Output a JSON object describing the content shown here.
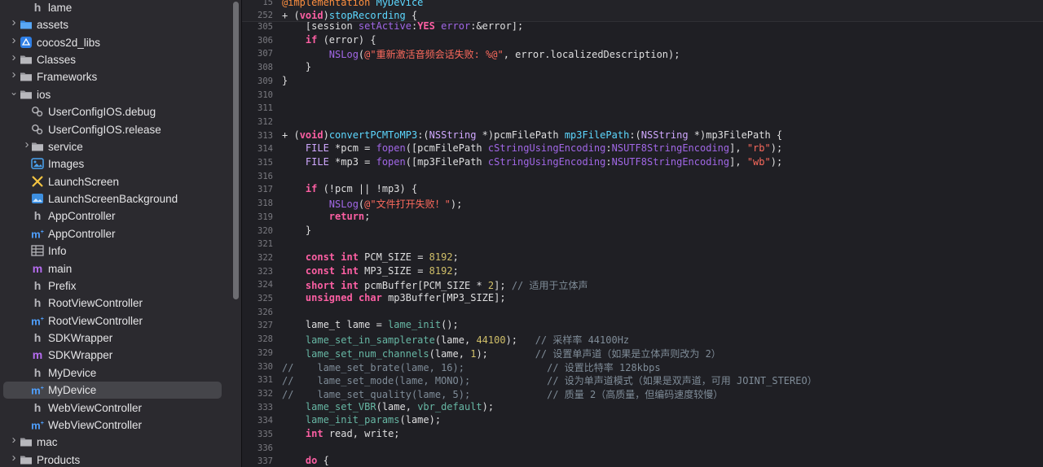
{
  "sidebar": {
    "items": [
      {
        "label": "lame",
        "icon": "header-file-icon",
        "kind": "h",
        "expandable": false,
        "indent": 1
      },
      {
        "label": "assets",
        "icon": "folder-icon-blue",
        "kind": "folder-blue",
        "expandable": true,
        "indent": 0
      },
      {
        "label": "cocos2d_libs",
        "icon": "xcode-project-icon",
        "kind": "project",
        "expandable": true,
        "indent": 0
      },
      {
        "label": "Classes",
        "icon": "folder-icon",
        "kind": "folder",
        "expandable": true,
        "indent": 0
      },
      {
        "label": "Frameworks",
        "icon": "folder-icon",
        "kind": "folder",
        "expandable": true,
        "indent": 0
      },
      {
        "label": "ios",
        "icon": "folder-icon",
        "kind": "folder",
        "expandable": true,
        "expanded": true,
        "indent": 0
      },
      {
        "label": "UserConfigIOS.debug",
        "icon": "xcconfig-icon",
        "kind": "config",
        "expandable": false,
        "indent": 1
      },
      {
        "label": "UserConfigIOS.release",
        "icon": "xcconfig-icon",
        "kind": "config",
        "expandable": false,
        "indent": 1
      },
      {
        "label": "service",
        "icon": "folder-icon",
        "kind": "folder",
        "expandable": true,
        "indent": 1
      },
      {
        "label": "Images",
        "icon": "asset-catalog-icon",
        "kind": "assets",
        "expandable": false,
        "indent": 1
      },
      {
        "label": "LaunchScreen",
        "icon": "storyboard-icon",
        "kind": "storyboard",
        "expandable": false,
        "indent": 1
      },
      {
        "label": "LaunchScreenBackground",
        "icon": "image-file-icon",
        "kind": "image",
        "expandable": false,
        "indent": 1
      },
      {
        "label": "AppController",
        "icon": "header-file-icon",
        "kind": "h",
        "expandable": false,
        "indent": 1
      },
      {
        "label": "AppController",
        "icon": "objcpp-file-icon",
        "kind": "mm",
        "expandable": false,
        "indent": 1
      },
      {
        "label": "Info",
        "icon": "plist-icon",
        "kind": "plist",
        "expandable": false,
        "indent": 1
      },
      {
        "label": "main",
        "icon": "objc-file-icon",
        "kind": "m",
        "expandable": false,
        "indent": 1
      },
      {
        "label": "Prefix",
        "icon": "header-file-icon",
        "kind": "h",
        "expandable": false,
        "indent": 1
      },
      {
        "label": "RootViewController",
        "icon": "header-file-icon",
        "kind": "h",
        "expandable": false,
        "indent": 1
      },
      {
        "label": "RootViewController",
        "icon": "objcpp-file-icon",
        "kind": "mm",
        "expandable": false,
        "indent": 1
      },
      {
        "label": "SDKWrapper",
        "icon": "header-file-icon",
        "kind": "h",
        "expandable": false,
        "indent": 1
      },
      {
        "label": "SDKWrapper",
        "icon": "objc-file-icon",
        "kind": "m",
        "expandable": false,
        "indent": 1
      },
      {
        "label": "MyDevice",
        "icon": "header-file-icon",
        "kind": "h",
        "expandable": false,
        "indent": 1
      },
      {
        "label": "MyDevice",
        "icon": "objcpp-file-icon",
        "kind": "mm",
        "expandable": false,
        "indent": 1,
        "selected": true
      },
      {
        "label": "WebViewController",
        "icon": "header-file-icon",
        "kind": "h",
        "expandable": false,
        "indent": 1
      },
      {
        "label": "WebViewController",
        "icon": "objcpp-file-icon",
        "kind": "mm",
        "expandable": false,
        "indent": 1
      },
      {
        "label": "mac",
        "icon": "folder-icon",
        "kind": "folder",
        "expandable": true,
        "indent": 0
      },
      {
        "label": "Products",
        "icon": "folder-icon",
        "kind": "folder",
        "expandable": true,
        "indent": 0
      }
    ]
  },
  "editor": {
    "sticky": [
      {
        "num": "15",
        "html": "<span class=\"pp\">@implementation</span> <span class=\"decl\">MyDevice</span>"
      },
      {
        "num": "252",
        "html": "+ (<span class=\"kw\">void</span>)<span class=\"decl\">stopRecording</span> {"
      }
    ],
    "lines": [
      {
        "num": "305",
        "html": "    [session <span class=\"mf\">setActive</span>:<span class=\"kw\">YES</span> <span class=\"mf\">error</span>:&amp;error];"
      },
      {
        "num": "306",
        "html": "    <span class=\"kw\">if</span> (error) {"
      },
      {
        "num": "307",
        "html": "        <span class=\"mf\">NSLog</span>(<span class=\"st\">@\"重新激活音频会话失败: %@\"</span>, error.localizedDescription);"
      },
      {
        "num": "308",
        "html": "    }"
      },
      {
        "num": "309",
        "html": "}"
      },
      {
        "num": "310",
        "html": ""
      },
      {
        "num": "311",
        "html": ""
      },
      {
        "num": "312",
        "html": ""
      },
      {
        "num": "313",
        "html": "+ (<span class=\"kw\">void</span>)<span class=\"decl\">convertPCMToMP3</span>:(<span class=\"cls\">NSString</span> *)pcmFilePath <span class=\"decl\">mp3FilePath</span>:(<span class=\"cls\">NSString</span> *)mp3FilePath {"
      },
      {
        "num": "314",
        "html": "    <span class=\"cls\">FILE</span> *pcm = <span class=\"mf\">fopen</span>([pcmFilePath <span class=\"mf\">cStringUsingEncoding</span>:<span class=\"mf\">NSUTF8StringEncoding</span>], <span class=\"st\">\"rb\"</span>);"
      },
      {
        "num": "315",
        "html": "    <span class=\"cls\">FILE</span> *mp3 = <span class=\"mf\">fopen</span>([mp3FilePath <span class=\"mf\">cStringUsingEncoding</span>:<span class=\"mf\">NSUTF8StringEncoding</span>], <span class=\"st\">\"wb\"</span>);"
      },
      {
        "num": "316",
        "html": ""
      },
      {
        "num": "317",
        "html": "    <span class=\"kw\">if</span> (!pcm || !mp3) {"
      },
      {
        "num": "318",
        "html": "        <span class=\"mf\">NSLog</span>(<span class=\"st\">@\"文件打开失败！\"</span>);"
      },
      {
        "num": "319",
        "html": "        <span class=\"kw\">return</span>;"
      },
      {
        "num": "320",
        "html": "    }"
      },
      {
        "num": "321",
        "html": ""
      },
      {
        "num": "322",
        "html": "    <span class=\"kw\">const</span> <span class=\"kw\">int</span> PCM_SIZE = <span class=\"nu\">8192</span>;"
      },
      {
        "num": "323",
        "html": "    <span class=\"kw\">const</span> <span class=\"kw\">int</span> MP3_SIZE = <span class=\"nu\">8192</span>;"
      },
      {
        "num": "324",
        "html": "    <span class=\"kw\">short</span> <span class=\"kw\">int</span> pcmBuffer[PCM_SIZE * <span class=\"nu\">2</span>]; <span class=\"cm\">// 适用于立体声</span>"
      },
      {
        "num": "325",
        "html": "    <span class=\"kw\">unsigned</span> <span class=\"kw\">char</span> mp3Buffer[MP3_SIZE];"
      },
      {
        "num": "326",
        "html": ""
      },
      {
        "num": "327",
        "html": "    lame_t lame = <span class=\"fn\">lame_init</span>();"
      },
      {
        "num": "328",
        "html": "    <span class=\"fn\">lame_set_in_samplerate</span>(lame, <span class=\"nu\">44100</span>);   <span class=\"cm\">// 采样率 44100Hz</span>"
      },
      {
        "num": "329",
        "html": "    <span class=\"fn\">lame_set_num_channels</span>(lame, <span class=\"nu\">1</span>);        <span class=\"cm\">// 设置单声道（如果是立体声则改为 2）</span>"
      },
      {
        "num": "330",
        "html": "<span class=\"cm\">//    lame_set_brate(lame, 16);              // 设置比特率 128kbps</span>"
      },
      {
        "num": "331",
        "html": "<span class=\"cm\">//    lame_set_mode(lame, MONO);             // 设为单声道模式（如果是双声道，可用 JOINT_STEREO）</span>"
      },
      {
        "num": "332",
        "html": "<span class=\"cm\">//    lame_set_quality(lame, 5);             // 质量 2（高质量，但编码速度较慢）</span>"
      },
      {
        "num": "333",
        "html": "    <span class=\"fn\">lame_set_VBR</span>(lame, <span class=\"fn\">vbr_default</span>);"
      },
      {
        "num": "334",
        "html": "    <span class=\"fn\">lame_init_params</span>(lame);"
      },
      {
        "num": "335",
        "html": "    <span class=\"kw\">int</span> read, write;"
      },
      {
        "num": "336",
        "html": ""
      },
      {
        "num": "337",
        "html": "    <span class=\"kw\">do</span> {"
      }
    ]
  }
}
